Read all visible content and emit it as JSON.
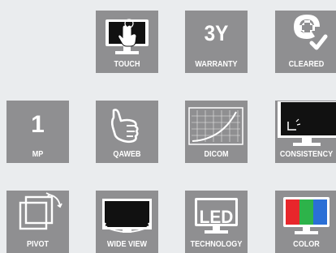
{
  "tiles": [
    {
      "id": "touch",
      "label": "TOUCH",
      "icon": "touch-monitor-icon"
    },
    {
      "id": "warranty",
      "label": "WARRANTY",
      "value": "3Y",
      "icon": "warranty-text"
    },
    {
      "id": "cleared",
      "label": "CLEARED",
      "icon": "medical-cross-check-icon"
    },
    {
      "id": "mp",
      "label": "MP",
      "value": "1",
      "icon": "megapixel-text"
    },
    {
      "id": "qaweb",
      "label": "QAWEB",
      "icon": "thumbs-up-icon"
    },
    {
      "id": "dicom",
      "label": "DICOM",
      "icon": "dicom-curve-monitor-icon"
    },
    {
      "id": "consistency",
      "label": "CONSISTENCY",
      "icon": "consistency-monitor-icon"
    },
    {
      "id": "pivot",
      "label": "PIVOT",
      "icon": "pivot-rotate-icon"
    },
    {
      "id": "wideview",
      "label": "WIDE VIEW",
      "icon": "wide-view-monitor-icon"
    },
    {
      "id": "technology",
      "label": "TECHNOLOGY",
      "value": "LED",
      "icon": "led-monitor-icon"
    },
    {
      "id": "color",
      "label": "COLOR",
      "icon": "rgb-monitor-icon"
    }
  ],
  "colors": {
    "page_background": "#eaecee",
    "tile_background": "#8f8f91",
    "icon_foreground": "#ffffff",
    "screen_dark": "#111111",
    "rgb_red": "#e8262b",
    "rgb_green": "#2db34a",
    "rgb_blue": "#2a6fd6"
  }
}
